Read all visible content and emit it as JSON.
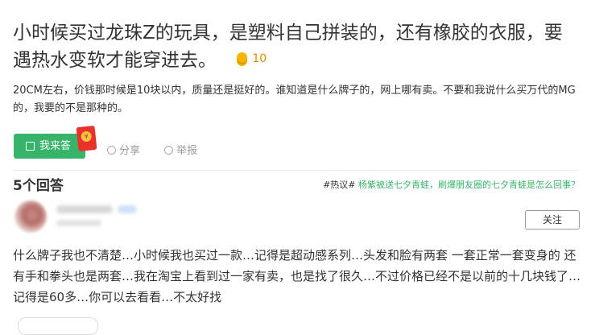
{
  "question": {
    "title": "小时候买过龙珠Z的玩具，是塑料自己拼装的，还有橡胶的衣服，要遇热水变软才能穿进去。",
    "reward": "10",
    "description": "20CM左右，价钱那时候是10块以内，质量还是挺好的。谁知道是什么牌子的，网上哪有卖。不要和我说什么买万代的MG的，我要的不是那种的。"
  },
  "actions": {
    "answer_label": "我来答",
    "share_label": "分享",
    "report_label": "举报"
  },
  "answers_header": {
    "count_label": "5个回答",
    "hot_tag": "#热议#",
    "hot_link": "杨紫被送七夕青蛙，刷爆朋友圈的七夕青蛙是怎么回事？"
  },
  "answer": {
    "follow_label": "关注",
    "text": "什么牌子我也不清楚…小时候我也买过一款…记得是超动感系列…头发和脸有两套 一套正常一套变身的 还有手和拳头也是两套…我在淘宝上看到过一家有卖，也是找了很久…不过价格已经不是以前的十几块钱了…记得是60多…你可以去看看…不太好找"
  },
  "colors": {
    "accent_green": "#38b36a",
    "reward_orange": "#e08a00",
    "redpack": "#e8322a"
  },
  "icons": {
    "answer_button": "edit-icon",
    "share": "share-icon",
    "report": "report-icon",
    "reward": "coin-icon",
    "redpack": "red-envelope-icon"
  }
}
